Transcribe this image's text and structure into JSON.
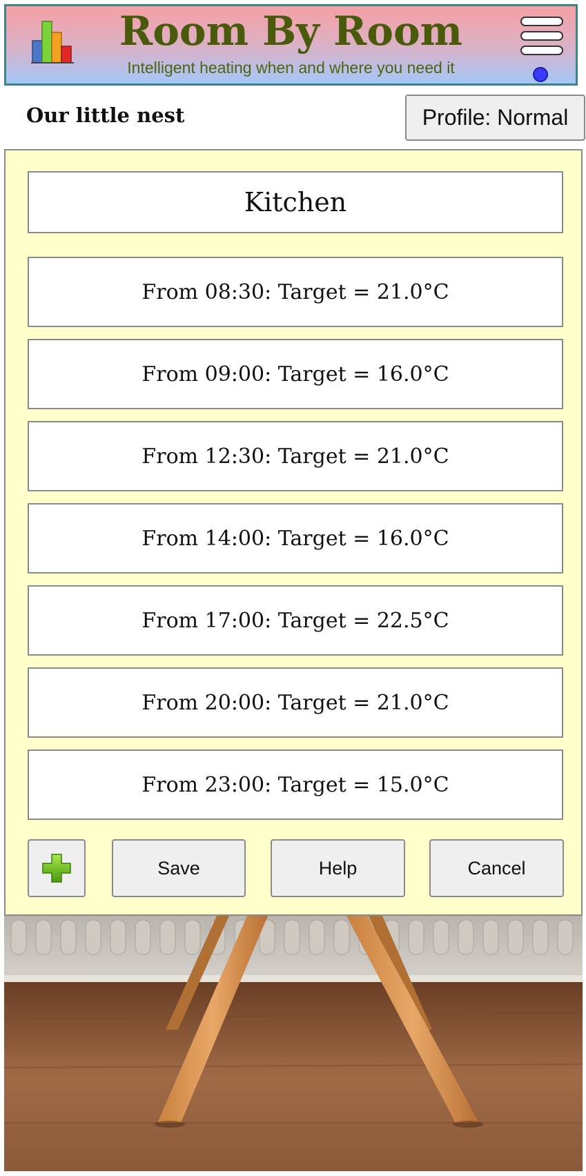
{
  "header": {
    "title": "Room By Room",
    "tagline": "Intelligent heating when and where you need it",
    "logo_icon": "bar-chart-icon",
    "menu_icon": "hamburger-menu-icon",
    "status_color": "#3b3bff"
  },
  "home": {
    "name": "Our little nest",
    "profile_label": "Profile: Normal"
  },
  "room": {
    "name": "Kitchen"
  },
  "schedule": [
    {
      "label": "From 08:30: Target = 21.0°C"
    },
    {
      "label": "From 09:00: Target = 16.0°C"
    },
    {
      "label": "From 12:30: Target = 21.0°C"
    },
    {
      "label": "From 14:00: Target = 16.0°C"
    },
    {
      "label": "From 17:00: Target = 22.5°C"
    },
    {
      "label": "From 20:00: Target = 21.0°C"
    },
    {
      "label": "From 23:00: Target = 15.0°C"
    }
  ],
  "actions": {
    "add_icon": "plus-icon",
    "save_label": "Save",
    "help_label": "Help",
    "cancel_label": "Cancel"
  },
  "colors": {
    "panel_background": "#ffffcc",
    "title_color": "#4a5a0c",
    "header_gradient_top": "#f6a0a4",
    "header_gradient_bottom": "#a4c8f8"
  }
}
